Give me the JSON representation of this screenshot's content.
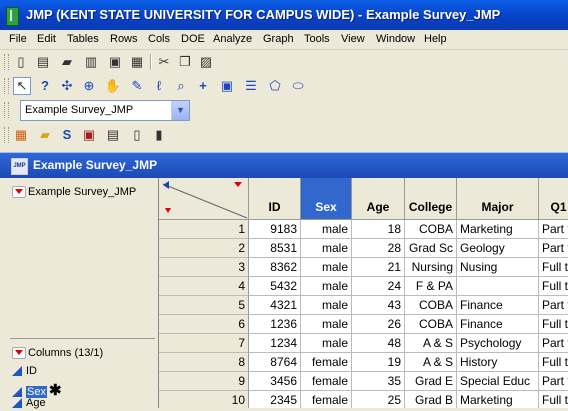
{
  "window": {
    "title": "JMP (KENT STATE UNIVERSITY FOR CAMPUS WIDE)  - Example Survey_JMP"
  },
  "menu": [
    "File",
    "Edit",
    "Tables",
    "Rows",
    "Cols",
    "DOE",
    "Analyze",
    "Graph",
    "Tools",
    "View",
    "Window",
    "Help"
  ],
  "toolbar1": {
    "icons": [
      "new-icon",
      "open-icon",
      "open-folder-icon",
      "import-icon",
      "save-icon",
      "print-icon",
      "cut-icon",
      "copy-icon",
      "paste-icon"
    ]
  },
  "toolbar2": {
    "icons": [
      "arrow-icon",
      "help-icon",
      "crosshair-icon",
      "target-icon",
      "hand-icon",
      "brush-icon",
      "lasso-icon",
      "magnifier-icon",
      "plus-icon",
      "text-icon",
      "line-icon",
      "polygon-icon",
      "ellipse-icon"
    ]
  },
  "table_select": {
    "value": "Example Survey_JMP"
  },
  "doc": {
    "title": "Example Survey_JMP"
  },
  "left_panel": {
    "table_name": "Example Survey_JMP",
    "columns_header": "Columns (13/1)",
    "columns": [
      "ID",
      "Sex",
      "Age"
    ],
    "star": "✱"
  },
  "grid": {
    "headers": [
      "ID",
      "Sex",
      "Age",
      "College",
      "Major",
      "Q1"
    ],
    "rows": [
      {
        "n": "1",
        "id": "9183",
        "sex": "male",
        "age": "18",
        "college": "COBA",
        "major": "Marketing",
        "q1": "Part t"
      },
      {
        "n": "2",
        "id": "8531",
        "sex": "male",
        "age": "28",
        "college": "Grad Sc",
        "major": "Geology",
        "q1": "Part t"
      },
      {
        "n": "3",
        "id": "8362",
        "sex": "male",
        "age": "21",
        "college": "Nursing",
        "major": "Nusing",
        "q1": "Full t"
      },
      {
        "n": "4",
        "id": "5432",
        "sex": "male",
        "age": "24",
        "college": "F & PA",
        "major": "",
        "q1": "Full t"
      },
      {
        "n": "5",
        "id": "4321",
        "sex": "male",
        "age": "43",
        "college": "COBA",
        "major": "Finance",
        "q1": "Part t"
      },
      {
        "n": "6",
        "id": "1236",
        "sex": "male",
        "age": "26",
        "college": "COBA",
        "major": "Finance",
        "q1": "Full t"
      },
      {
        "n": "7",
        "id": "1234",
        "sex": "male",
        "age": "48",
        "college": "A & S",
        "major": "Psychology",
        "q1": "Part t"
      },
      {
        "n": "8",
        "id": "8764",
        "sex": "female",
        "age": "19",
        "college": "A & S",
        "major": "History",
        "q1": "Full t"
      },
      {
        "n": "9",
        "id": "3456",
        "sex": "female",
        "age": "35",
        "college": "Grad E",
        "major": "Special Educ",
        "q1": "Part t"
      },
      {
        "n": "10",
        "id": "2345",
        "sex": "female",
        "age": "25",
        "college": "Grad B",
        "major": "Marketing",
        "q1": "Full t"
      }
    ]
  },
  "colors": {
    "title_blue": "#0842c8",
    "selected_header": "#3267cd",
    "chrome": "#ece9d8"
  }
}
